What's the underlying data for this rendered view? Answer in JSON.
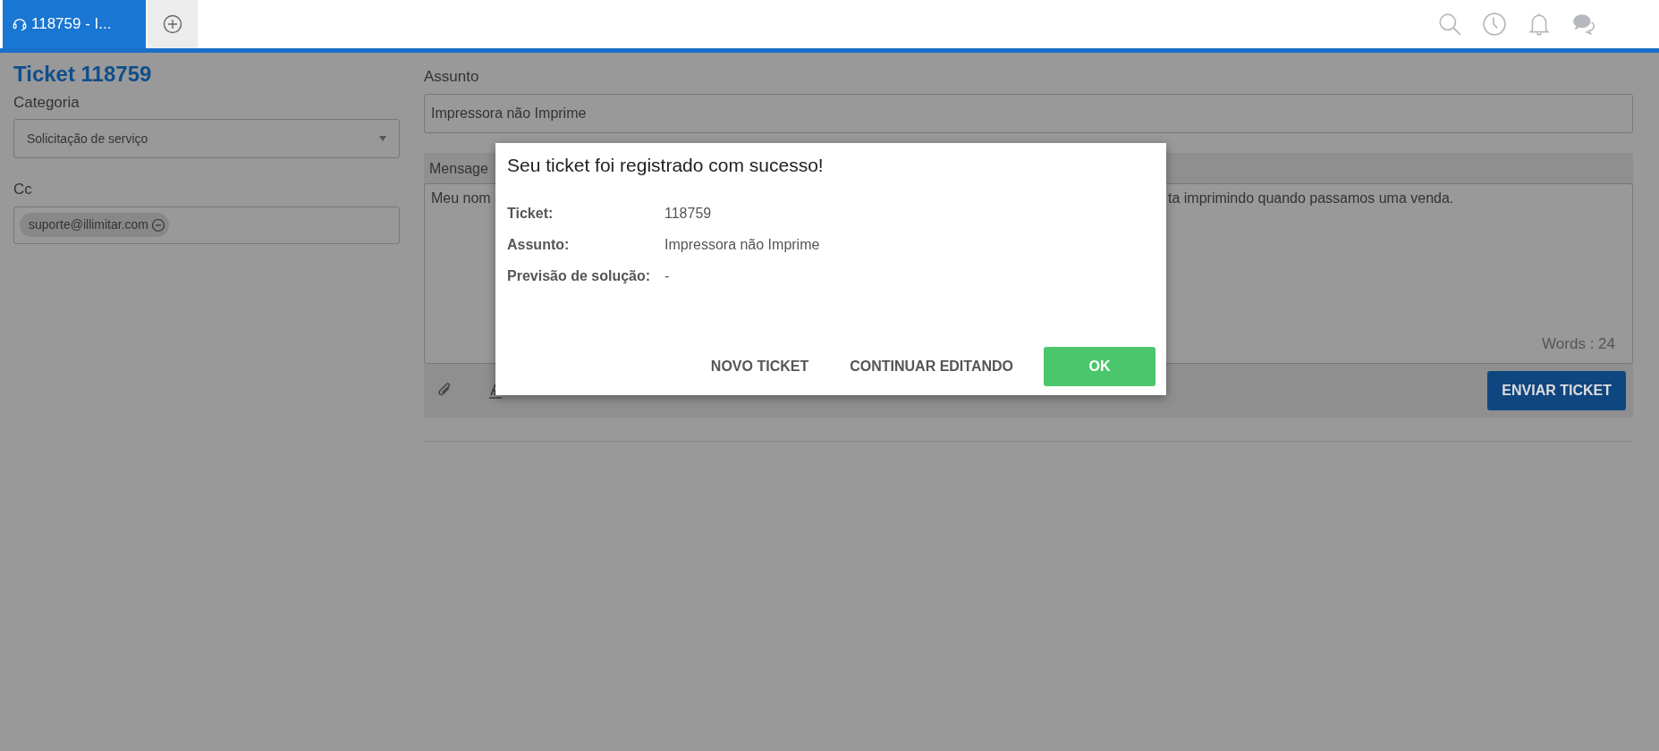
{
  "tabs": [
    {
      "kind": "ticket",
      "label": "118759 - I...",
      "selected": true
    },
    {
      "kind": "add",
      "selected": false
    }
  ],
  "ticket": {
    "title": "Ticket 118759",
    "category_label": "Categoria",
    "category_value": "Solicitação de serviço",
    "cc_label": "Cc",
    "cc_chips": [
      "suporte@illimitar.com"
    ],
    "subject_label": "Assunto",
    "subject_value": "Impressora não Imprime",
    "message_label": "Mensage",
    "message_fragments": [
      "Meu nom",
      "ta imprimindo quando passamos uma venda."
    ],
    "word_count": "Words : 24",
    "send_button": "ENVIAR TICKET"
  },
  "dialog": {
    "title": "Seu ticket foi registrado com sucesso!",
    "rows": [
      {
        "label": "Ticket:",
        "value": "118759"
      },
      {
        "label": "Assunto:",
        "value": "Impressora não Imprime"
      },
      {
        "label": "Previsão de solução:",
        "value": "-"
      }
    ],
    "buttons": [
      {
        "kind": "text",
        "label": "NOVO TICKET"
      },
      {
        "kind": "text",
        "label": "CONTINUAR EDITANDO"
      },
      {
        "kind": "primary",
        "label": "OK"
      }
    ]
  }
}
